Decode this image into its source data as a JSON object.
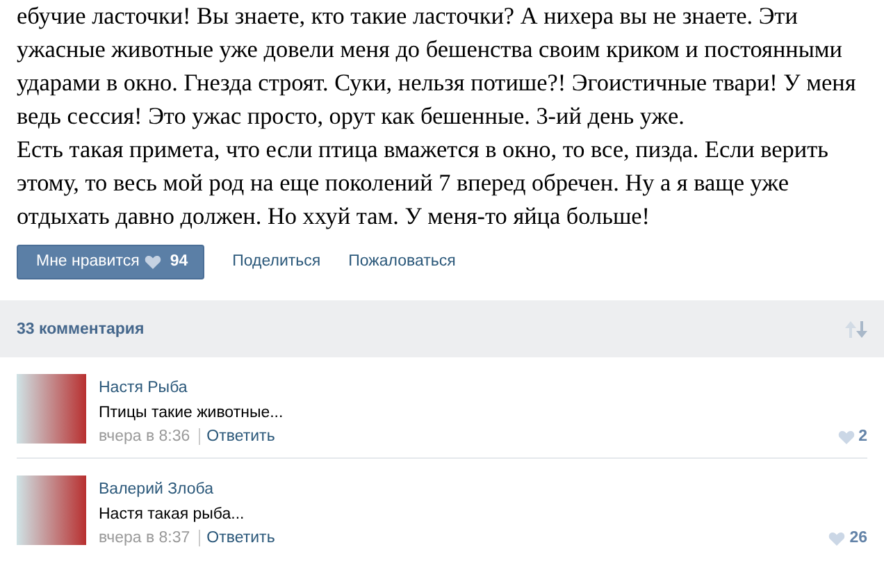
{
  "post": {
    "paragraphs": [
      "ебучие ласточки! Вы знаете, кто такие ласточки? А нихера вы не знаете. Эти ужасные животные уже довели меня до бешенства своим криком и постоянными ударами в окно. Гнезда строят. Суки, нельзя потише?! Эгоистичные твари! У меня ведь сессия! Это ужас просто, орут как бешенные. 3-ий день уже.",
      "Есть такая примета, что если птица вмажется в окно, то все, пизда. Если верить этому, то весь мой род на еще поколений 7 вперед обречен. Ну а я ваще уже отдыхать давно должен. Но ххуй там. У меня-то яйца больше!"
    ]
  },
  "actions": {
    "like_label": "Мне нравится",
    "like_count": "94",
    "links": [
      "Поделиться",
      "Пожаловаться"
    ]
  },
  "comments_header": {
    "title": "33 комментария"
  },
  "comments": [
    {
      "author": "Настя Рыба",
      "text": "Птицы такие животные...",
      "time": "вчера в 8:36",
      "reply": "Ответить",
      "likes": "2"
    },
    {
      "author": "Валерий Злоба",
      "text": "Настя такая рыба...",
      "time": "вчера в 8:37",
      "reply": "Ответить",
      "likes": "26"
    }
  ]
}
